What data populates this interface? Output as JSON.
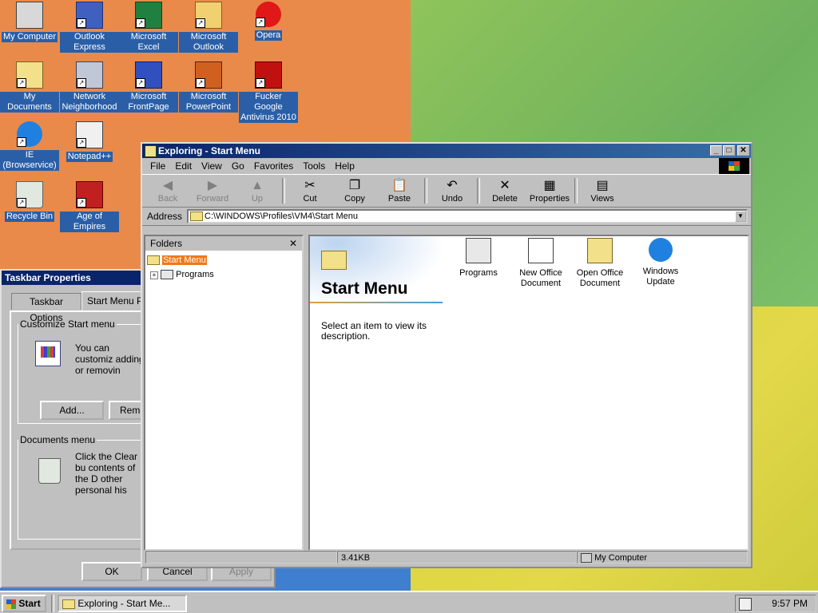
{
  "desktop_icons": [
    {
      "id": "my-computer",
      "label": "My Computer",
      "icon": "computer-icon"
    },
    {
      "id": "outlook-express",
      "label": "Outlook Express",
      "icon": "outlook-express-icon"
    },
    {
      "id": "excel",
      "label": "Microsoft Excel",
      "icon": "excel-icon"
    },
    {
      "id": "outlook",
      "label": "Microsoft Outlook",
      "icon": "outlook-icon"
    },
    {
      "id": "opera",
      "label": "Opera",
      "icon": "opera-icon"
    },
    {
      "id": "my-documents",
      "label": "My Documents",
      "icon": "documents-folder-icon"
    },
    {
      "id": "network",
      "label": "Network Neighborhood",
      "icon": "network-icon"
    },
    {
      "id": "frontpage",
      "label": "Microsoft FrontPage",
      "icon": "frontpage-icon"
    },
    {
      "id": "powerpoint",
      "label": "Microsoft PowerPoint",
      "icon": "powerpoint-icon"
    },
    {
      "id": "antivirus",
      "label": "Fucker Google Antivirus 2010",
      "icon": "antivirus-icon"
    },
    {
      "id": "ie",
      "label": "IE (Browservice)",
      "icon": "ie-icon"
    },
    {
      "id": "notepadpp",
      "label": "Notepad++",
      "icon": "notepad-icon"
    },
    {
      "id": "recycle",
      "label": "Recycle Bin",
      "icon": "recycle-bin-icon"
    },
    {
      "id": "aoe",
      "label": "Age of Empires",
      "icon": "age-of-empires-icon"
    }
  ],
  "taskbar_props": {
    "title": "Taskbar Properties",
    "tabs": [
      "Taskbar Options",
      "Start Menu Pr"
    ],
    "group1_title": "Customize Start menu",
    "group1_text": "You can customiz adding or removin",
    "add_btn": "Add...",
    "remove_btn": "Remo",
    "group2_title": "Documents menu",
    "group2_text": "Click the Clear bu contents of the D other personal his",
    "ok": "OK",
    "cancel": "Cancel",
    "apply": "Apply"
  },
  "explorer": {
    "title": "Exploring - Start Menu",
    "menu": [
      "File",
      "Edit",
      "View",
      "Go",
      "Favorites",
      "Tools",
      "Help"
    ],
    "toolbar": [
      {
        "label": "Back",
        "glyph": "◀",
        "enabled": false
      },
      {
        "label": "Forward",
        "glyph": "▶",
        "enabled": false
      },
      {
        "label": "Up",
        "glyph": "▲",
        "enabled": false
      },
      {
        "label": "Cut",
        "glyph": "✂",
        "enabled": true
      },
      {
        "label": "Copy",
        "glyph": "❐",
        "enabled": true
      },
      {
        "label": "Paste",
        "glyph": "📋",
        "enabled": true
      },
      {
        "label": "Undo",
        "glyph": "↶",
        "enabled": true
      },
      {
        "label": "Delete",
        "glyph": "✕",
        "enabled": true
      },
      {
        "label": "Properties",
        "glyph": "▦",
        "enabled": true
      },
      {
        "label": "Views",
        "glyph": "▤",
        "enabled": true
      }
    ],
    "address_label": "Address",
    "address_value": "C:\\WINDOWS\\Profiles\\VM4\\Start Menu",
    "folders_header": "Folders",
    "tree": [
      {
        "label": "Start Menu",
        "selected": true
      },
      {
        "label": "Programs",
        "selected": false
      }
    ],
    "webview_title": "Start Menu",
    "webview_desc": "Select an item to view its description.",
    "items": [
      {
        "label": "Programs",
        "icon": "programs-folder-icon"
      },
      {
        "label": "New Office Document",
        "icon": "new-office-document-icon"
      },
      {
        "label": "Open Office Document",
        "icon": "open-office-document-icon"
      },
      {
        "label": "Windows Update",
        "icon": "windows-update-icon"
      }
    ],
    "status_size": "3.41KB",
    "status_zone": "My Computer"
  },
  "taskbar": {
    "start": "Start",
    "task": "Exploring - Start Me...",
    "clock": "9:57 PM"
  },
  "colors": {
    "titlebar": "#0a246a",
    "desktop_blue": "#3e7fd0",
    "face": "#c0c0c0"
  }
}
